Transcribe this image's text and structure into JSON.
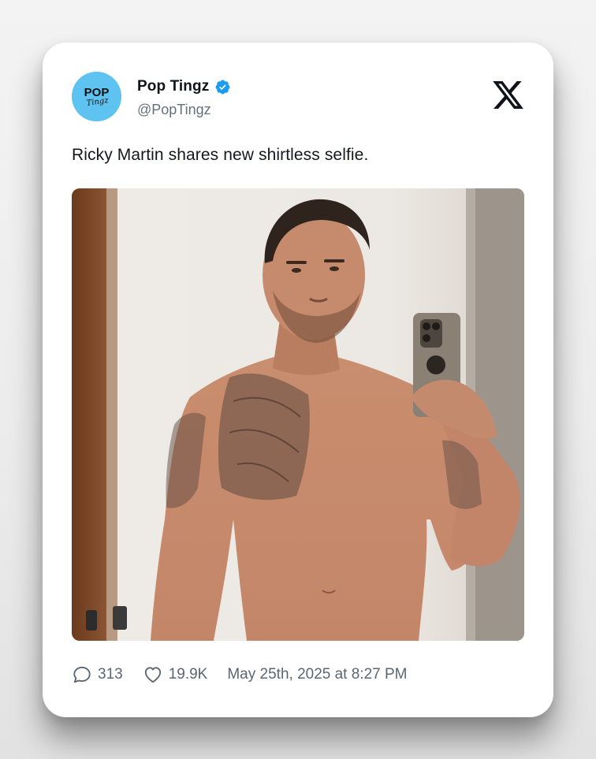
{
  "tweet": {
    "author": {
      "display_name": "Pop Tingz",
      "handle": "@PopTingz",
      "verified": true,
      "avatar_text": [
        "POP",
        "Tingz"
      ],
      "avatar_color": "#5ec3f0"
    },
    "text": "Ricky Martin shares new shirtless selfie.",
    "media": {
      "kind": "photo",
      "description_icon": "photo"
    },
    "stats": {
      "replies": "313",
      "likes": "19.9K"
    },
    "timestamp": "May 25th, 2025 at 8:27 PM"
  },
  "icons": {
    "brand": "x-logo-icon",
    "verified": "verified-badge-icon",
    "reply": "comment-icon",
    "like": "heart-icon"
  },
  "colors": {
    "verified_blue": "#1d9bf0",
    "text_primary": "#0f1419",
    "text_secondary": "#5b6670"
  }
}
